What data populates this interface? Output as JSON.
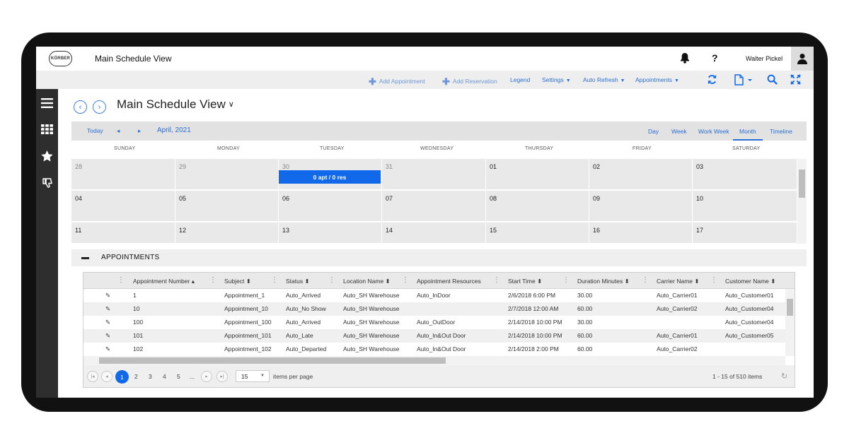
{
  "app": {
    "logo_text": "KÖRBER",
    "title": "Main Schedule View",
    "user_name": "Walter Pickel",
    "help_label": "?"
  },
  "toolbar": {
    "add_appointment": "Add Appointment",
    "add_reservation": "Add Reservation",
    "legend": "Legend",
    "settings": "Settings",
    "auto_refresh": "Auto Refresh",
    "appointments": "Appointments"
  },
  "page": {
    "title": "Main Schedule View",
    "prev": "‹",
    "next": "›"
  },
  "calendar": {
    "today": "Today",
    "prev": "◂",
    "next": "▸",
    "month": "April, 2021",
    "views": [
      "Day",
      "Week",
      "Work Week",
      "Month",
      "Timeline"
    ],
    "active_view": "Month",
    "weekdays": [
      "SUNDAY",
      "MONDAY",
      "TUESDAY",
      "WEDNESDAY",
      "THURSDAY",
      "FRIDAY",
      "SATURDAY"
    ],
    "weeks": [
      [
        "28",
        "29",
        "30",
        "31",
        "01",
        "02",
        "03"
      ],
      [
        "04",
        "05",
        "06",
        "07",
        "08",
        "09",
        "10"
      ],
      [
        "11",
        "12",
        "13",
        "14",
        "15",
        "16",
        "17"
      ]
    ],
    "event_label": "0 apt / 0 res",
    "accent": "#1168e8"
  },
  "appointments_panel": {
    "title": "APPOINTMENTS",
    "columns": [
      "Appointment Number",
      "Subject",
      "Status",
      "Location Name",
      "Appointment Resources",
      "Start Time",
      "Duration Minutes",
      "Carrier Name",
      "Customer Name"
    ],
    "rows": [
      [
        "1",
        "Appointment_1",
        "Auto_Arrived",
        "Auto_SH Warehouse",
        "Auto_InDoor",
        "2/6/2018 6:00 PM",
        "30.00",
        "Auto_Carrier01",
        "Auto_Customer01"
      ],
      [
        "10",
        "Appointment_10",
        "Auto_No Show",
        "Auto_SH Warehouse",
        "",
        "2/7/2018 12:00 AM",
        "60.00",
        "Auto_Carrier02",
        "Auto_Customer04"
      ],
      [
        "100",
        "Appointment_100",
        "Auto_Arrived",
        "Auto_SH Warehouse",
        "Auto_OutDoor",
        "2/14/2018 10:00 PM",
        "30.00",
        "",
        "Auto_Customer04"
      ],
      [
        "101",
        "Appointment_101",
        "Auto_Late",
        "Auto_SH Warehouse",
        "Auto_In&Out Door",
        "2/14/2018 10:00 PM",
        "60.00",
        "Auto_Carrier01",
        "Auto_Customer05"
      ],
      [
        "102",
        "Appointment_102",
        "Auto_Departed",
        "Auto_SH Warehouse",
        "Auto_In&Out Door",
        "2/14/2018 2:00 PM",
        "60.00",
        "Auto_Carrier02",
        ""
      ]
    ],
    "pager": {
      "current": "1",
      "pages": [
        "2",
        "3",
        "4",
        "5",
        "..."
      ],
      "page_size": "15",
      "page_size_label": "items per page",
      "info": "1 - 15 of 510 items"
    }
  }
}
